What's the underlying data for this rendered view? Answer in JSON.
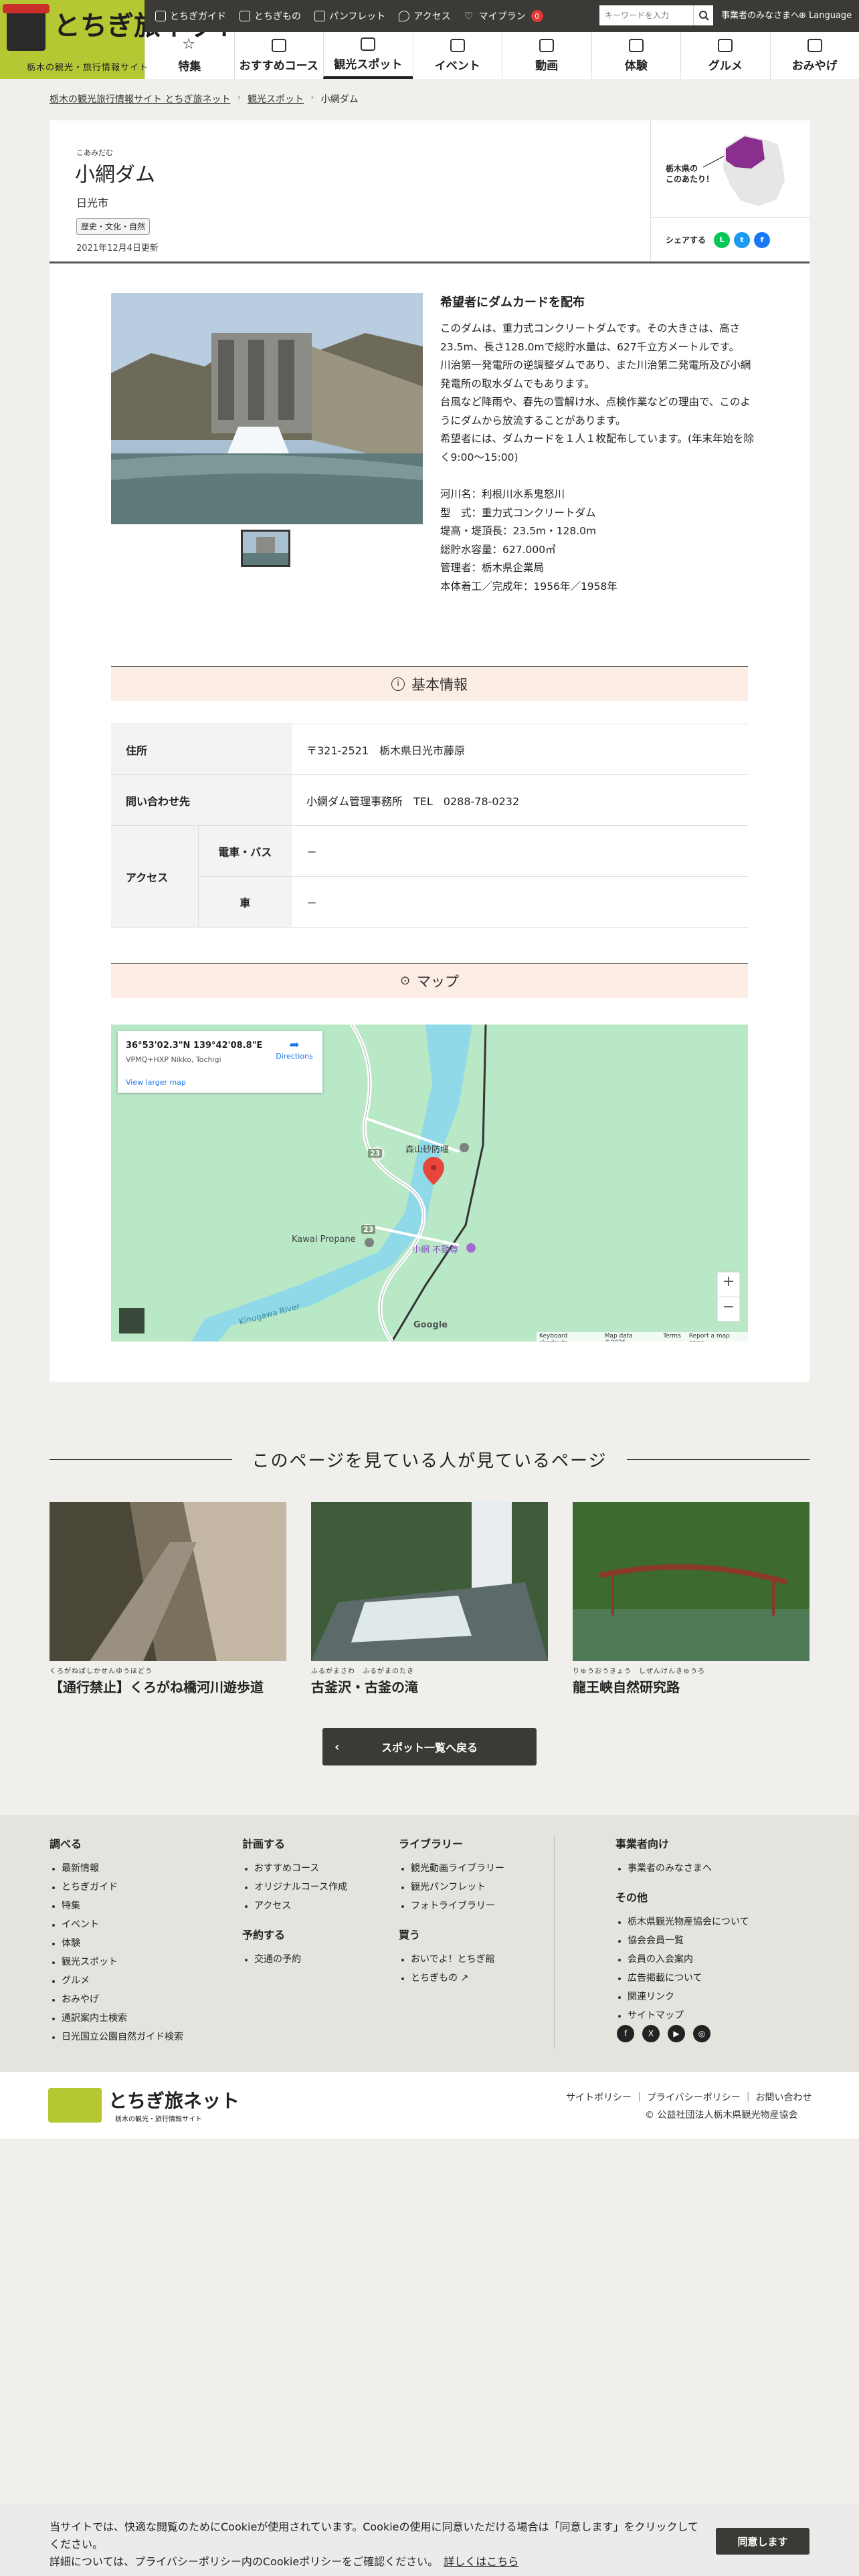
{
  "header": {
    "site_name": "とちぎ旅ネット",
    "tagline": "栃木の観光・旅行情報サイト",
    "utility": [
      {
        "label": "とちぎガイド",
        "icon": "guide-icon"
      },
      {
        "label": "とちぎもの",
        "icon": "bag-icon"
      },
      {
        "label": "パンフレット",
        "icon": "book-icon"
      },
      {
        "label": "アクセス",
        "icon": "pin-icon"
      },
      {
        "label": "マイプラン",
        "icon": "heart-icon",
        "badge": "0"
      }
    ],
    "search_placeholder": "キーワードを入力",
    "biz_link": "事業者のみなさまへ",
    "language": "Language",
    "nav": [
      {
        "label": "特集",
        "icon": "star-icon"
      },
      {
        "label": "おすすめコース",
        "icon": "route-icon"
      },
      {
        "label": "観光スポット",
        "icon": "camera-icon"
      },
      {
        "label": "イベント",
        "icon": "calendar-icon"
      },
      {
        "label": "動画",
        "icon": "video-icon"
      },
      {
        "label": "体験",
        "icon": "experience-icon"
      },
      {
        "label": "グルメ",
        "icon": "fork-icon"
      },
      {
        "label": "おみやげ",
        "icon": "gift-icon"
      }
    ]
  },
  "breadcrumb": [
    "栃木の観光旅行情報サイト とちぎ旅ネット",
    "観光スポット",
    "小網ダム"
  ],
  "spot": {
    "ruby": "こあみだむ",
    "title": "小網ダム",
    "city": "日光市",
    "category": "歴史・文化・自然",
    "updated": "2021年12月4日更新",
    "map_label_1": "栃木県の",
    "map_label_2": "このあたり！",
    "share_label": "シェアする"
  },
  "description": {
    "heading": "希望者にダムカードを配布",
    "paragraphs": [
      "このダムは、重力式コンクリートダムです。その大きさは、高さ23.5m、長さ128.0mで総貯水量は、627千立方メートルです。",
      "川治第一発電所の逆調整ダムであり、また川治第二発電所及び小網発電所の取水ダムでもあります。",
      "台風など降雨や、春先の雪解け水、点検作業などの理由で、このようにダムから放流することがあります。",
      "希望者には、ダムカードを１人１枚配布しています。(年末年始を除く9:00～15:00)"
    ],
    "specs": [
      "河川名：利根川水系鬼怒川",
      "型　式：重力式コンクリートダム",
      "堤高・堤頂長：23.5m・128.0m",
      "総貯水容量：627.000㎥",
      "管理者：栃木県企業局",
      "本体着工／完成年：1956年／1958年"
    ]
  },
  "basic_info": {
    "heading": "基本情報",
    "address_label": "住所",
    "address": "〒321-2521　栃木県日光市藤原",
    "contact_label": "問い合わせ先",
    "contact": "小網ダム管理事務所　TEL　0288-78-0232",
    "access_label": "アクセス",
    "train_label": "電車・バス",
    "train": "－",
    "car_label": "車",
    "car": "－"
  },
  "map": {
    "heading": "マップ",
    "coords": "36°53'02.3\"N 139°42'08.8\"E",
    "plus_code": "VPMQ+HXP Nikko, Tochigi",
    "larger": "View larger map",
    "directions": "Directions",
    "labels": [
      "森山砂防堰",
      "Kawai Propane",
      "小網 不動尊",
      "Kinugawa River"
    ],
    "route_numbers": [
      "23",
      "23"
    ],
    "attribution": [
      "Keyboard shortcuts",
      "Map data ©2025",
      "Terms",
      "Report a map error"
    ],
    "google": "Google"
  },
  "related": {
    "heading": "このページを見ている人が見ているページ",
    "items": [
      {
        "ruby": "くろがねばしかせんゆうほどう",
        "title": "【通行禁止】くろがね橋河川遊歩道"
      },
      {
        "ruby": "ふるがまさわ　ふるがまのたき",
        "title": "古釜沢・古釜の滝"
      },
      {
        "ruby": "りゅうおうきょう　しぜんけんきゅうろ",
        "title": "龍王峡自然研究路"
      }
    ],
    "back": "スポット一覧へ戻る"
  },
  "footer": {
    "col1": {
      "heading": "調べる",
      "items": [
        "最新情報",
        "とちぎガイド",
        "特集",
        "イベント",
        "体験",
        "観光スポット",
        "グルメ",
        "おみやげ",
        "通訳案内士検索",
        "日光国立公園自然ガイド検索"
      ]
    },
    "col2": {
      "heading": "計画する",
      "items": [
        "おすすめコース",
        "オリジナルコース作成",
        "アクセス"
      ],
      "heading2": "予約する",
      "items2": [
        "交通の予約"
      ]
    },
    "col3": {
      "heading": "ライブラリー",
      "items": [
        "観光動画ライブラリー",
        "観光パンフレット",
        "フォトライブラリー"
      ],
      "heading2": "買う",
      "items2": [
        "おいでよ！とちぎ館",
        "とちぎもの ↗"
      ]
    },
    "col4": {
      "heading": "事業者向け",
      "items": [
        "事業者のみなさまへ"
      ],
      "heading2": "その他",
      "items2": [
        "栃木県観光物産協会について",
        "協会会員一覧",
        "会員の入会案内",
        "広告掲載について",
        "関連リンク",
        "サイトマップ"
      ]
    },
    "bottom_links": "サイトポリシー ｜ プライバシーポリシー ｜ お問い合わせ",
    "copyright": "© 公益社団法人栃木県観光物産協会"
  },
  "cookie": {
    "text": "当サイトでは、快適な閲覧のためにCookieが使用されています。Cookieの使用に同意いただける場合は「同意します」をクリックしてください。",
    "text2": "詳細については、プライバシーポリシー内のCookieポリシーをご確認ください。",
    "more": "詳しくはこちら",
    "agree": "同意します"
  }
}
